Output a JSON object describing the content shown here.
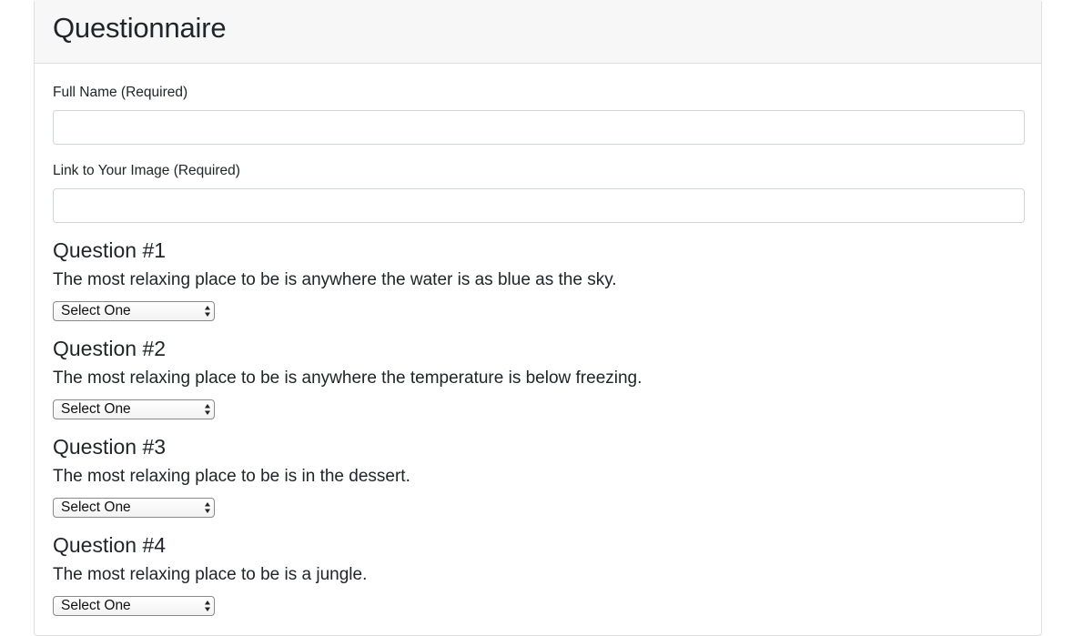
{
  "form": {
    "title": "Questionnaire",
    "full_name_label": "Full Name (Required)",
    "full_name_value": "",
    "image_link_label": "Link to Your Image (Required)",
    "image_link_value": ""
  },
  "questions": [
    {
      "heading": "Question #1",
      "text": "The most relaxing place to be is anywhere the water is as blue as the sky.",
      "selected": "Select One"
    },
    {
      "heading": "Question #2",
      "text": "The most relaxing place to be is anywhere the temperature is below freezing.",
      "selected": "Select One"
    },
    {
      "heading": "Question #3",
      "text": "The most relaxing place to be is in the dessert.",
      "selected": "Select One"
    },
    {
      "heading": "Question #4",
      "text": "The most relaxing place to be is a jungle.",
      "selected": "Select One"
    }
  ],
  "icons": {
    "select_arrow": "up-down-arrows-icon"
  }
}
